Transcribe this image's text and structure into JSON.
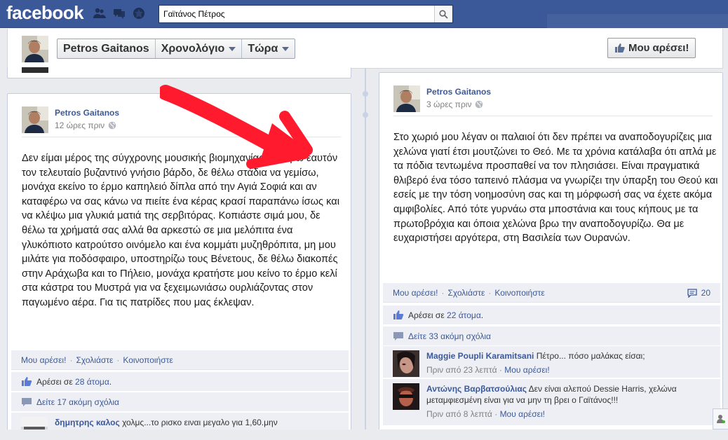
{
  "topbar": {
    "logo": "facebook",
    "search_value": "Γαϊτάνος Πέτρος",
    "jewels": [
      "friend-requests-icon",
      "messages-icon",
      "notifications-icon"
    ]
  },
  "header": {
    "name": "Petros Gaitanos",
    "timeline_label": "Χρονολόγιο",
    "now_label": "Τώρα",
    "like_button": "Μου αρέσει!"
  },
  "left_post": {
    "author": "Petros Gaitanos",
    "time": "12 ώρες πριν",
    "text": "Δεν είμαι μέρος της σύγχρονης μουσικής βιομηχανίας. Θεωρώ εαυτόν τον τελευταίο βυζαντινό γνήσιο βάρδο, δε θέλω στάδια να γεμίσω, μονάχα εκείνο το έρμο καπηλειό δίπλα από την Αγιά Σοφιά και αν καταφέρω να σας κάνω να πιείτε ένα κέρας κρασί παραπάνω ίσως και να κλέψω μια γλυκιά ματιά της σερβιτόρας. Κοπιάστε σιμά μου, δε θέλω τα χρήματά σας αλλά θα αρκεστώ σε μια μελόπιτα ένα γλυκόπιοτο κατρούτσο οινόμελο και ένα κομμάτι μυζηθρόπιτα, μη μου μιλάτε για ποδόσφαιρο, υποστηρίζω τους Βένετους, δε θέλω διακοπές στην Αράχωβα και το Πήλειο, μονάχα κρατήστε μου κείνο το έρμο κελί στα κάστρα του Μυστρά για να ξεχειμωνιάσω ουρλιάζοντας στον παγωμένο αέρα. Για τις πατρίδες που μας έκλεψαν.",
    "actions": {
      "like": "Μου αρέσει!",
      "comment": "Σχολιάστε",
      "share": "Κοινοποιήστε"
    },
    "likes_prefix": "Αρέσει σε",
    "likes_link": "28 άτομα",
    "likes_suffix": ".",
    "more_comments": "Δείτε 17 ακόμη σχόλια",
    "comment": {
      "name": "δημητρης καλος",
      "text": "χολμς...το ρισκο ειναι μεγαλο για 1,60.μην"
    }
  },
  "right_post": {
    "author": "Petros Gaitanos",
    "time": "3 ώρες πριν",
    "text": "Στο χωριό μου λέγαν οι παλαιοί ότι δεν πρέπει να αναποδογυρίζεις μια χελώνα γιατί έτσι μουτζώνει το Θεό. Με τα χρόνια κατάλαβα ότι απλά με τα πόδια τεντωμένα προσπαθεί να τον πλησιάσει. Είναι πραγματικά θλιβερό ένα τόσο ταπεινό πλάσμα να γνωρίζει την ύπαρξη του Θεού και εσείς με την τόση νοημοσύνη σας και τη μόρφωσή σας να έχετε ακόμα αμφιβολίες. Από τότε γυρνάω στα μποστάνια και τους κήπους με τα πρωτοβρόχια και όποια χελώνα βρω την αναποδογυρίζω. Θα με ευχαριστήσει αργότερα, στη Βασιλεία των Ουρανών.",
    "actions": {
      "like": "Μου αρέσει!",
      "comment": "Σχολιάστε",
      "share": "Κοινοποιήστε"
    },
    "comments_count": "20",
    "likes_prefix": "Αρέσει σε",
    "likes_link": "22 άτομα",
    "likes_suffix": ".",
    "more_comments": "Δείτε 33 ακόμη σχόλια",
    "comments": [
      {
        "name": "Maggie Poupli Karamitsani",
        "text": "Πέτρο... πόσο μαλάκας είσαι;",
        "time": "Πριν από 23 λεπτά",
        "like": "Μου αρέσει!"
      },
      {
        "name": "Αντώνης Βαρβατσούλιας",
        "text": "Δεν είναι αλεπού Dessie Harris, χελώνα μεταμφιεσμένη είναι για να μην τη βρει ο Γαϊτάνος!!!",
        "time": "Πριν από 8 λεπτά",
        "like": "Μου αρέσει!"
      }
    ]
  },
  "colors": {
    "brand": "#3b5998",
    "annotation_arrow": "#ff1a2e"
  }
}
